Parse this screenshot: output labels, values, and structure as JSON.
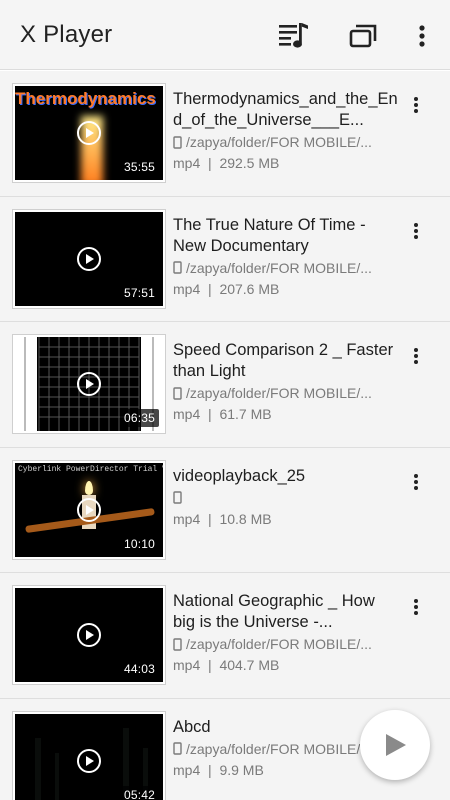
{
  "app": {
    "title": "X Player",
    "accent": "#222222"
  },
  "toolbar": {
    "playlist_icon": "playlist-music-icon",
    "window_icon": "popup-window-icon",
    "overflow_icon": "more-vertical-icon"
  },
  "videos": [
    {
      "name": "Thermodynamics_and_the_End_of_the_Universe___E...",
      "path": "/zapya/folder/FOR MOBILE/...",
      "format": "mp4",
      "size": "292.5 MB",
      "duration": "35:55",
      "thumb_text": "Thermodynamics"
    },
    {
      "name": "The True Nature Of Time - New Documentary",
      "path": "/zapya/folder/FOR MOBILE/...",
      "format": "mp4",
      "size": "207.6 MB",
      "duration": "57:51"
    },
    {
      "name": "Speed Comparison 2 _ Faster than Light",
      "path": "/zapya/folder/FOR MOBILE/...",
      "format": "mp4",
      "size": "61.7 MB",
      "duration": "06:35"
    },
    {
      "name": "videoplayback_25",
      "path": "",
      "format": "mp4",
      "size": "10.8 MB",
      "duration": "10:10",
      "thumb_text": "Cyberlink PowerDirector Trial Version"
    },
    {
      "name": "National Geographic _ How big is the Universe -...",
      "path": "/zapya/folder/FOR MOBILE/...",
      "format": "mp4",
      "size": "404.7 MB",
      "duration": "44:03"
    },
    {
      "name": "Abcd",
      "path": "/zapya/folder/FOR MOBILE/...",
      "format": "mp4",
      "size": "9.9 MB",
      "duration": "05:42"
    }
  ],
  "separator": "|",
  "fab": {
    "icon": "play-icon"
  }
}
